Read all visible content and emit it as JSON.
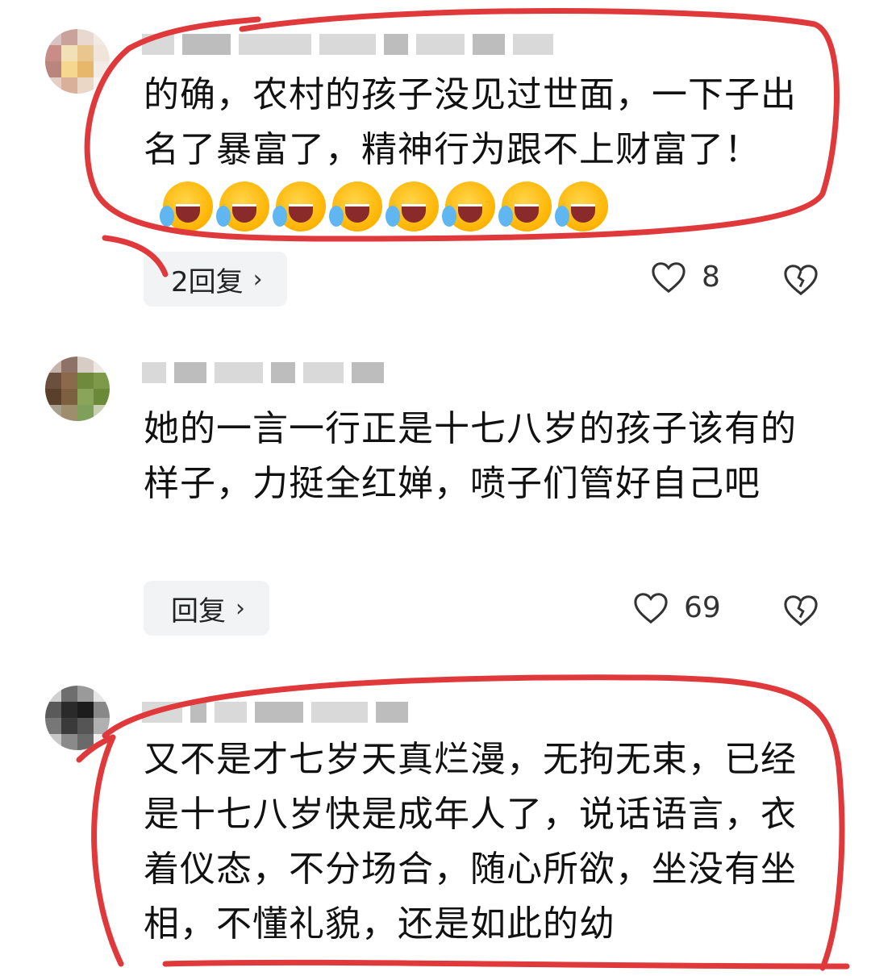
{
  "comments": [
    {
      "text": "的确，农村的孩子没见过世面，一下子出名了暴富了，精神行为跟不上财富了！",
      "emoji_count": 8,
      "reply_label": "2回复",
      "likes": "8"
    },
    {
      "text": "她的一言一行正是十七八岁的孩子该有的样子，力挺全红婵，喷子们管好自己吧",
      "reply_label": "回复",
      "likes": "69"
    },
    {
      "text": "又不是才七岁天真烂漫，无拘无束，已经是十七八岁快是成年人了，说话语言，衣着仪态，不分场合，随心所欲，坐没有坐相，不懂礼貌，还是如此的幼"
    }
  ],
  "icons": {
    "emoji": "loudly-laughing-face-icon",
    "like": "heart-icon",
    "dislike": "broken-heart-icon",
    "chevron": "chevron-right-icon"
  },
  "colors": {
    "annotation": "#e0393b",
    "reply_bg": "#f2f3f5"
  }
}
